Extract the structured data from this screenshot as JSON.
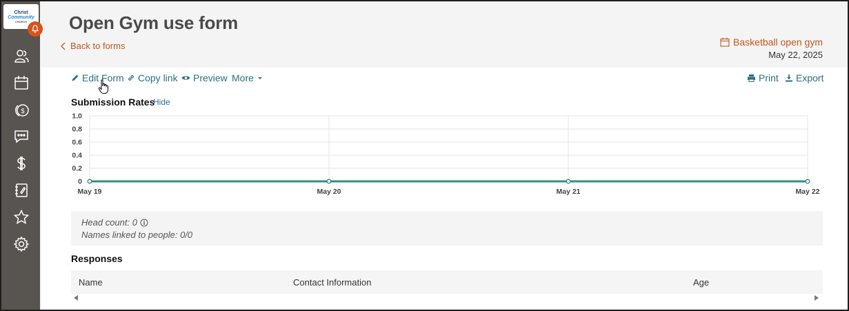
{
  "logo": {
    "line1": "Christ",
    "line2": "Community",
    "line3": "CHURCH"
  },
  "sidebar": {
    "items": [
      {
        "name": "people",
        "icon": "people-icon"
      },
      {
        "name": "calendar",
        "icon": "calendar-icon"
      },
      {
        "name": "giving",
        "icon": "giving-coin-icon"
      },
      {
        "name": "messages",
        "icon": "chat-icon"
      },
      {
        "name": "finance",
        "icon": "dollar-icon"
      },
      {
        "name": "forms",
        "icon": "notebook-icon"
      },
      {
        "name": "favorites",
        "icon": "star-icon"
      },
      {
        "name": "settings",
        "icon": "gear-icon"
      }
    ]
  },
  "header": {
    "title": "Open Gym use form",
    "back_label": "Back to forms",
    "event_name": "Basketball open gym",
    "event_date": "May 22, 2025"
  },
  "actions": {
    "edit": "Edit Form",
    "copy": "Copy link",
    "preview": "Preview",
    "more": "More",
    "print": "Print",
    "export": "Export"
  },
  "chart_section": {
    "title": "Submission Rates",
    "hide_label": "Hide"
  },
  "chart_data": {
    "type": "line",
    "x": [
      "May 19",
      "May 20",
      "May 21",
      "May 22"
    ],
    "series": [
      {
        "values": [
          0,
          0,
          0,
          0
        ]
      }
    ],
    "y_ticks": [
      "1.0",
      "0.8",
      "0.6",
      "0.4",
      "0.2",
      "0"
    ],
    "ylim": [
      0,
      1
    ],
    "grid": true,
    "line_color": "#2f8f83"
  },
  "stats": {
    "head_count": "Head count: 0",
    "names_linked": "Names linked to people: 0/0"
  },
  "responses": {
    "title": "Responses",
    "columns": [
      "Name",
      "Contact Information",
      "Age"
    ]
  },
  "colors": {
    "accent": "#c0561c",
    "link": "#2a6f84",
    "sidebar": "#585550",
    "bell": "#d9531e"
  }
}
